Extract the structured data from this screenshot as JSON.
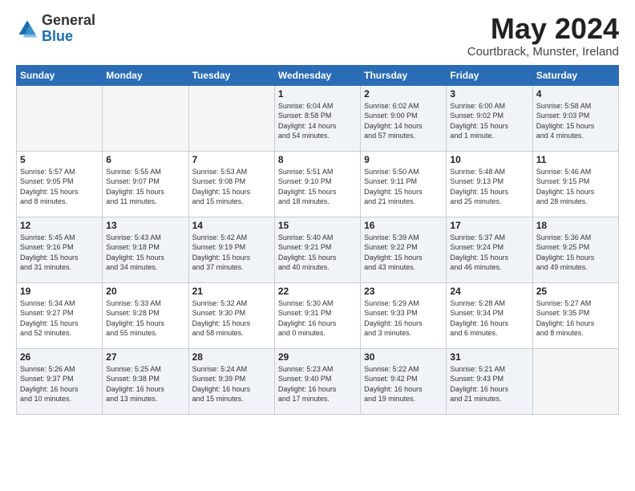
{
  "logo": {
    "general": "General",
    "blue": "Blue"
  },
  "title": "May 2024",
  "subtitle": "Courtbrack, Munster, Ireland",
  "headers": [
    "Sunday",
    "Monday",
    "Tuesday",
    "Wednesday",
    "Thursday",
    "Friday",
    "Saturday"
  ],
  "weeks": [
    [
      {
        "num": "",
        "info": ""
      },
      {
        "num": "",
        "info": ""
      },
      {
        "num": "",
        "info": ""
      },
      {
        "num": "1",
        "info": "Sunrise: 6:04 AM\nSunset: 8:58 PM\nDaylight: 14 hours\nand 54 minutes."
      },
      {
        "num": "2",
        "info": "Sunrise: 6:02 AM\nSunset: 9:00 PM\nDaylight: 14 hours\nand 57 minutes."
      },
      {
        "num": "3",
        "info": "Sunrise: 6:00 AM\nSunset: 9:02 PM\nDaylight: 15 hours\nand 1 minute."
      },
      {
        "num": "4",
        "info": "Sunrise: 5:58 AM\nSunset: 9:03 PM\nDaylight: 15 hours\nand 4 minutes."
      }
    ],
    [
      {
        "num": "5",
        "info": "Sunrise: 5:57 AM\nSunset: 9:05 PM\nDaylight: 15 hours\nand 8 minutes."
      },
      {
        "num": "6",
        "info": "Sunrise: 5:55 AM\nSunset: 9:07 PM\nDaylight: 15 hours\nand 11 minutes."
      },
      {
        "num": "7",
        "info": "Sunrise: 5:53 AM\nSunset: 9:08 PM\nDaylight: 15 hours\nand 15 minutes."
      },
      {
        "num": "8",
        "info": "Sunrise: 5:51 AM\nSunset: 9:10 PM\nDaylight: 15 hours\nand 18 minutes."
      },
      {
        "num": "9",
        "info": "Sunrise: 5:50 AM\nSunset: 9:11 PM\nDaylight: 15 hours\nand 21 minutes."
      },
      {
        "num": "10",
        "info": "Sunrise: 5:48 AM\nSunset: 9:13 PM\nDaylight: 15 hours\nand 25 minutes."
      },
      {
        "num": "11",
        "info": "Sunrise: 5:46 AM\nSunset: 9:15 PM\nDaylight: 15 hours\nand 28 minutes."
      }
    ],
    [
      {
        "num": "12",
        "info": "Sunrise: 5:45 AM\nSunset: 9:16 PM\nDaylight: 15 hours\nand 31 minutes."
      },
      {
        "num": "13",
        "info": "Sunrise: 5:43 AM\nSunset: 9:18 PM\nDaylight: 15 hours\nand 34 minutes."
      },
      {
        "num": "14",
        "info": "Sunrise: 5:42 AM\nSunset: 9:19 PM\nDaylight: 15 hours\nand 37 minutes."
      },
      {
        "num": "15",
        "info": "Sunrise: 5:40 AM\nSunset: 9:21 PM\nDaylight: 15 hours\nand 40 minutes."
      },
      {
        "num": "16",
        "info": "Sunrise: 5:39 AM\nSunset: 9:22 PM\nDaylight: 15 hours\nand 43 minutes."
      },
      {
        "num": "17",
        "info": "Sunrise: 5:37 AM\nSunset: 9:24 PM\nDaylight: 15 hours\nand 46 minutes."
      },
      {
        "num": "18",
        "info": "Sunrise: 5:36 AM\nSunset: 9:25 PM\nDaylight: 15 hours\nand 49 minutes."
      }
    ],
    [
      {
        "num": "19",
        "info": "Sunrise: 5:34 AM\nSunset: 9:27 PM\nDaylight: 15 hours\nand 52 minutes."
      },
      {
        "num": "20",
        "info": "Sunrise: 5:33 AM\nSunset: 9:28 PM\nDaylight: 15 hours\nand 55 minutes."
      },
      {
        "num": "21",
        "info": "Sunrise: 5:32 AM\nSunset: 9:30 PM\nDaylight: 15 hours\nand 58 minutes."
      },
      {
        "num": "22",
        "info": "Sunrise: 5:30 AM\nSunset: 9:31 PM\nDaylight: 16 hours\nand 0 minutes."
      },
      {
        "num": "23",
        "info": "Sunrise: 5:29 AM\nSunset: 9:33 PM\nDaylight: 16 hours\nand 3 minutes."
      },
      {
        "num": "24",
        "info": "Sunrise: 5:28 AM\nSunset: 9:34 PM\nDaylight: 16 hours\nand 6 minutes."
      },
      {
        "num": "25",
        "info": "Sunrise: 5:27 AM\nSunset: 9:35 PM\nDaylight: 16 hours\nand 8 minutes."
      }
    ],
    [
      {
        "num": "26",
        "info": "Sunrise: 5:26 AM\nSunset: 9:37 PM\nDaylight: 16 hours\nand 10 minutes."
      },
      {
        "num": "27",
        "info": "Sunrise: 5:25 AM\nSunset: 9:38 PM\nDaylight: 16 hours\nand 13 minutes."
      },
      {
        "num": "28",
        "info": "Sunrise: 5:24 AM\nSunset: 9:39 PM\nDaylight: 16 hours\nand 15 minutes."
      },
      {
        "num": "29",
        "info": "Sunrise: 5:23 AM\nSunset: 9:40 PM\nDaylight: 16 hours\nand 17 minutes."
      },
      {
        "num": "30",
        "info": "Sunrise: 5:22 AM\nSunset: 9:42 PM\nDaylight: 16 hours\nand 19 minutes."
      },
      {
        "num": "31",
        "info": "Sunrise: 5:21 AM\nSunset: 9:43 PM\nDaylight: 16 hours\nand 21 minutes."
      },
      {
        "num": "",
        "info": ""
      }
    ]
  ],
  "row_classes": [
    "row-bg-alt",
    "row-bg-light",
    "row-bg-alt",
    "row-bg-light",
    "row-bg-alt"
  ]
}
